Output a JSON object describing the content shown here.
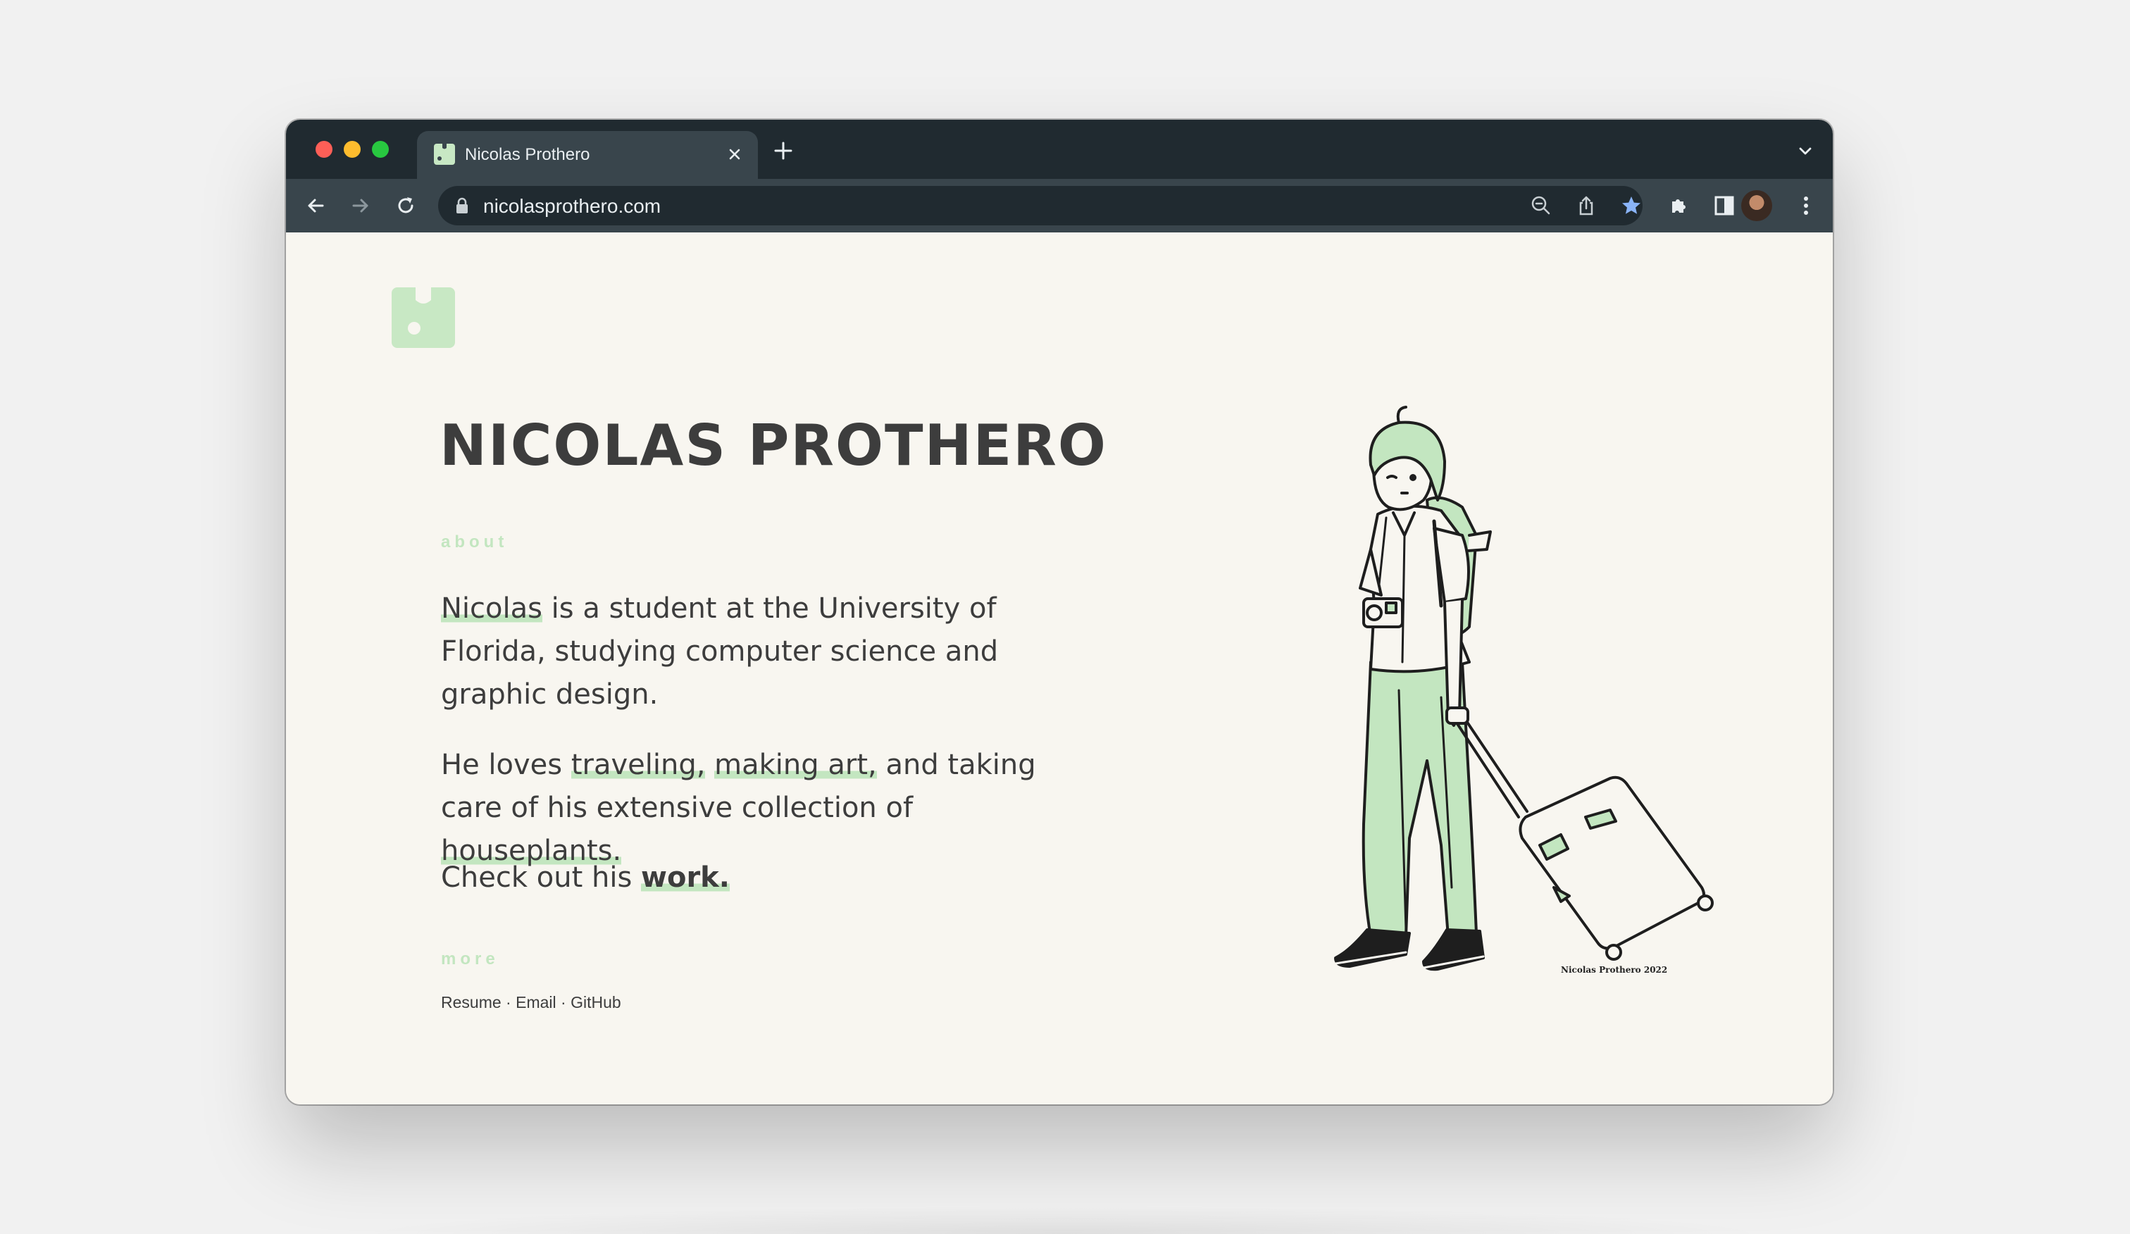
{
  "browser": {
    "tab_title": "Nicolas Prothero",
    "url": "nicolasprothero.com",
    "icons": [
      "back-arrow-icon",
      "forward-arrow-icon",
      "reload-icon",
      "lock-icon",
      "zoom-icon",
      "share-icon",
      "star-icon",
      "extensions-icon",
      "side-panel-icon",
      "profile-avatar",
      "kebab-menu-icon",
      "close-icon",
      "plus-icon",
      "chevron-down-icon"
    ]
  },
  "site": {
    "name": "NICOLAS PROTHERO",
    "about_label": "about",
    "about": {
      "p1_link": "Nicolas",
      "p1_text": " is a student at the University of Florida, studying computer science and graphic design.",
      "p2_a": "He loves ",
      "p2_link1": "traveling,",
      "p2_b": " ",
      "p2_link2": "making art,",
      "p2_c": " and taking care of his extensive collection of ",
      "p2_link3": "houseplants.",
      "p3_a": "Check out his ",
      "p3_link": "work."
    },
    "more_label": "more",
    "more_links": [
      "Resume",
      "Email",
      "GitHub"
    ],
    "more_separator": " · ",
    "signature": "Nicolas Prothero 2022"
  },
  "colors": {
    "accent": "#c3e6c0",
    "text": "#3d3d3d",
    "page_bg": "#f8f6f0",
    "chrome_dark": "#202a30",
    "chrome_mid": "#39454c"
  }
}
